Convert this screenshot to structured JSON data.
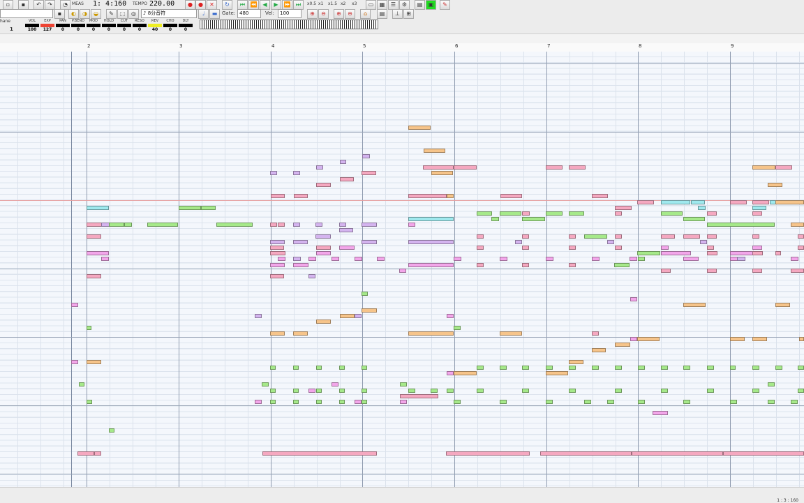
{
  "toolbar": {
    "position_label": "MEAS",
    "position": "1: 4:160",
    "tempo_label": "TEMPO",
    "tempo": "220.00",
    "note_length": "8分音符",
    "gate_label": "Gate:",
    "gate": "480",
    "vel_label": "Vel:",
    "vel": "100",
    "play_rates": [
      "x0.5",
      "x1",
      "x1.5",
      "x2",
      "x3"
    ]
  },
  "mixer": {
    "track_label": "hane",
    "track_value": "1",
    "channels": [
      {
        "label": "VOL",
        "value": "100"
      },
      {
        "label": "EXP",
        "value": "127"
      },
      {
        "label": "PAN",
        "value": "0"
      },
      {
        "label": "P.BEND",
        "value": "0"
      },
      {
        "label": "MOD",
        "value": "0"
      },
      {
        "label": "HOLD",
        "value": "0"
      },
      {
        "label": "CUT",
        "value": "0"
      },
      {
        "label": "RESO",
        "value": "0"
      },
      {
        "label": "REV",
        "value": "40"
      },
      {
        "label": "CHO",
        "value": "0"
      },
      {
        "label": "DLY",
        "value": "0"
      }
    ]
  },
  "ruler": {
    "measures": [
      "2",
      "3",
      "4",
      "5",
      "6",
      "7",
      "8",
      "9"
    ]
  },
  "colors": {
    "green": "#a6e98a",
    "pink": "#f5a8c0",
    "orange": "#f6c48a",
    "purple": "#d4b4ef",
    "cyan": "#9fe9ee",
    "magenta": "#f3a6ea"
  },
  "statusbar": {
    "position": "1 : 3 : 160"
  }
}
